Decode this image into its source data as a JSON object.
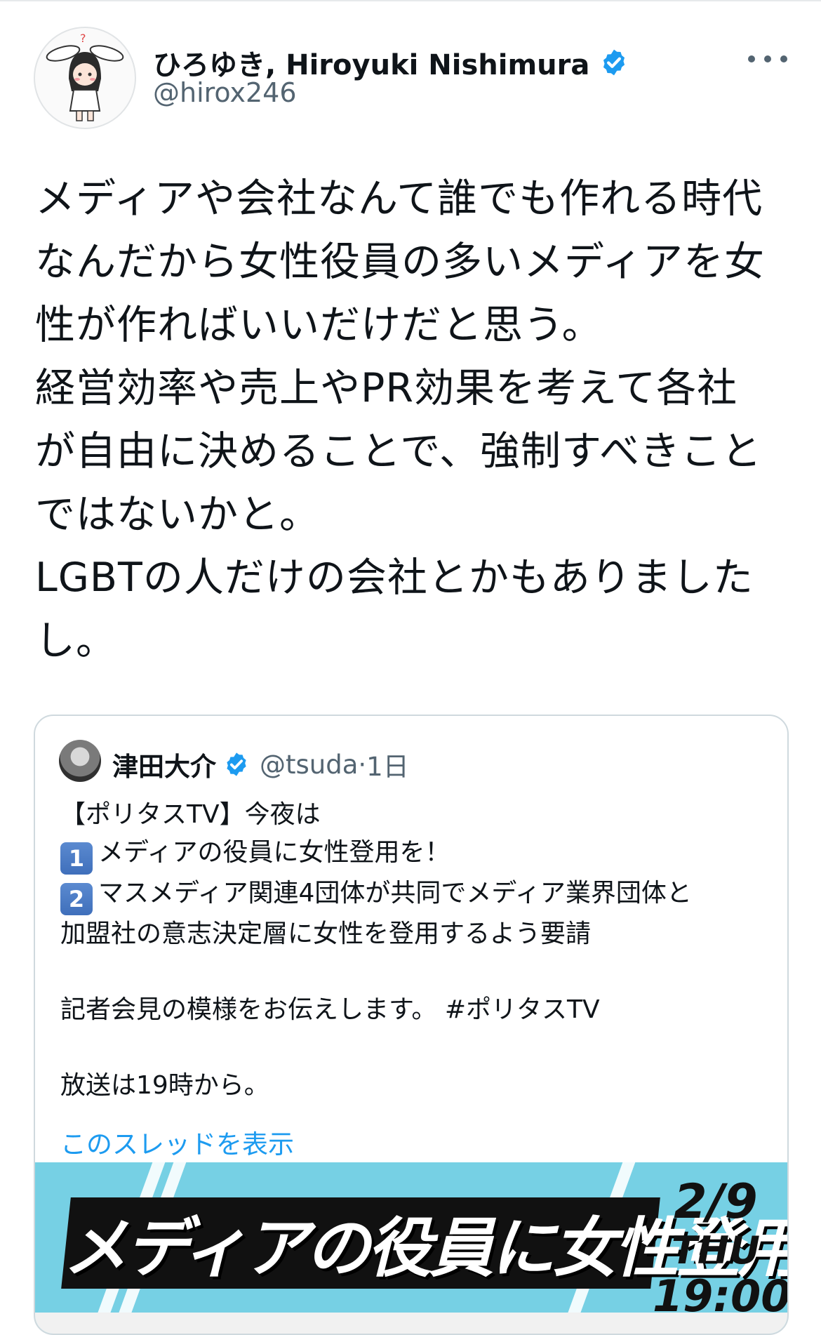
{
  "tweet": {
    "display_name": "ひろゆき, Hiroyuki Nishimura",
    "handle": "@hirox246",
    "text": "メディアや会社なんて誰でも作れる時代\nなんだから女性役員の多いメディアを女\n性が作ればいいだけだと思う。\n経営効率や売上やPR効果を考えて各社\nが自由に決めることで、強制すべきこと\nではないかと。\nLGBTの人だけの会社とかもありました\nし。"
  },
  "quote": {
    "name": "津田大介",
    "handle": "@tsuda",
    "time": "1日",
    "separator": "·",
    "line1": "【ポリタスTV】今夜は",
    "item1_num": "1",
    "item1_text": "メディアの役員に女性登用を！",
    "item2_num": "2",
    "item2_text": "マスメディア関連4団体が共同でメディア業界団体と",
    "line_cont": "加盟社の意志決定層に女性を登用するよう要請",
    "line_press": "記者会見の模様をお伝えします。 #ポリタスTV",
    "line_broadcast": "放送は19時から。",
    "show_thread": "このスレッドを表示"
  },
  "banner": {
    "title": "メディアの役員に女性登用を!",
    "date": "2/9",
    "weekday": "THU",
    "time": "19:00"
  },
  "icons": {
    "verified": "verified-badge-icon",
    "more": "more-options-icon"
  },
  "colors": {
    "link": "#1d9bf0",
    "secondary_text": "#536471",
    "verified": "#1d9bf0",
    "banner_bg": "#76d0e4"
  }
}
